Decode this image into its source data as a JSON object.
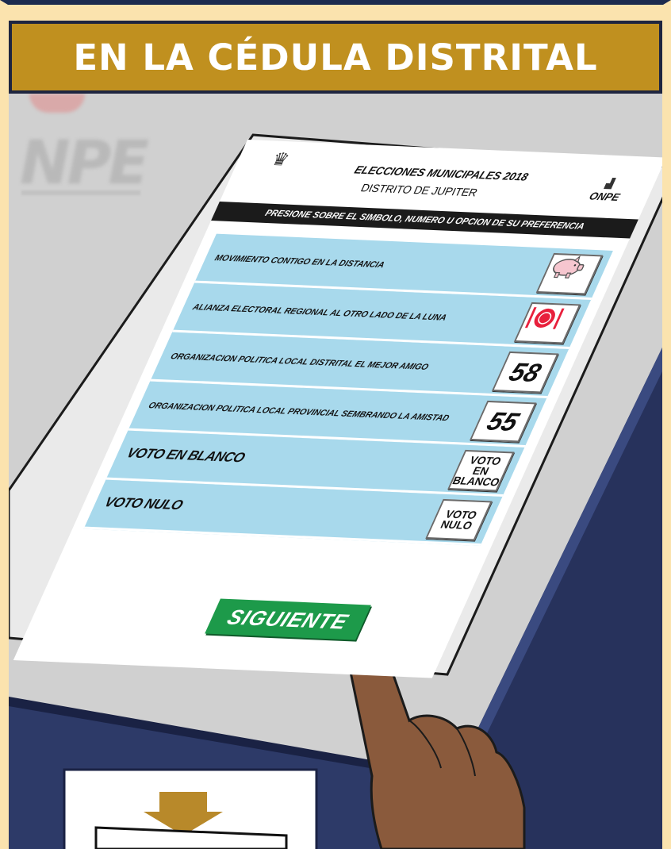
{
  "banner": {
    "title": "EN LA CÉDULA DISTRITAL"
  },
  "background": {
    "logo_text": "NPE"
  },
  "screen": {
    "election_title": "ELECCIONES MUNICIPALES 2018",
    "district": "DISTRITO DE JUPITER",
    "brand": "ONPE",
    "instruction": "PRESIONE SOBRE EL SIMBOLO, NUMERO U OPCION DE SU PREFERENCIA",
    "options": [
      {
        "label": "MOVIMIENTO CONTIGO EN LA DISTANCIA",
        "symbol": "piggy-bank-icon"
      },
      {
        "label": "ALIANZA ELECTORAL REGIONAL AL OTRO LADO DE LA LUNA",
        "symbol": "plate-cutlery-icon"
      },
      {
        "label": "ORGANIZACION POLITICA LOCAL DISTRITAL EL MEJOR AMIGO",
        "number": "58"
      },
      {
        "label": "ORGANIZACION POLITICA LOCAL PROVINCIAL SEMBRANDO LA AMISTAD",
        "number": "55"
      },
      {
        "label": "VOTO EN BLANCO",
        "box_line1": "VOTO EN",
        "box_line2": "BLANCO"
      },
      {
        "label": "VOTO NULO",
        "box_line1": "VOTO",
        "box_line2": "NULO"
      }
    ],
    "next_button": "SIGUIENTE"
  },
  "colors": {
    "banner": "#c0901f",
    "option_row": "#a8d9ec",
    "next_button": "#1d9a4a",
    "kiosk_body": "#2c3966",
    "accent_red": "#e8203c"
  }
}
